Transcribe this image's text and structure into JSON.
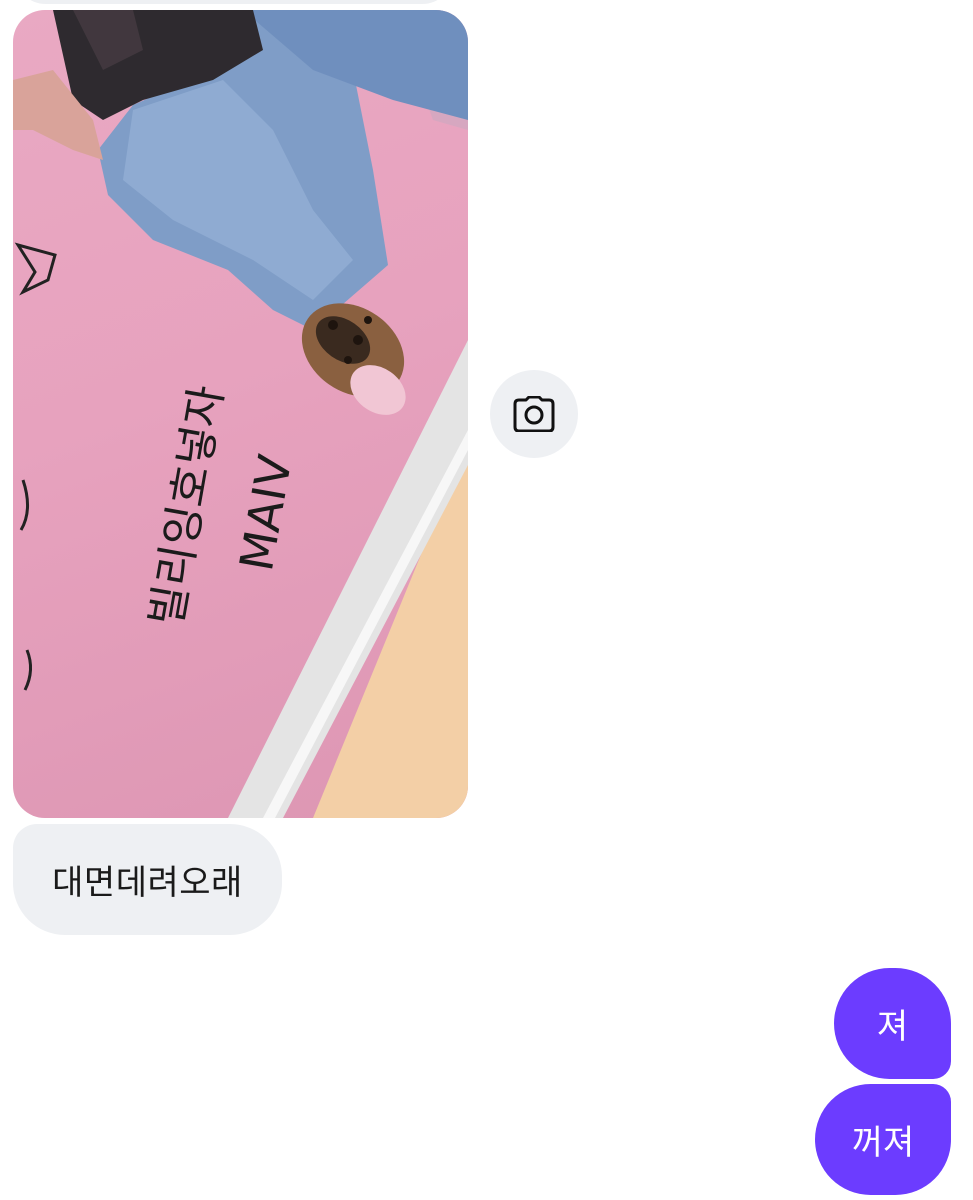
{
  "conversation": {
    "photo_message": {
      "image_description_icon": "photo-icon",
      "handwriting_main": "빌리잉호넣자",
      "handwriting_sub": "MAIV"
    },
    "camera_button": {
      "icon": "camera-icon"
    },
    "received_messages": [
      {
        "text": "대면데려오래"
      }
    ],
    "sent_messages": [
      {
        "text": "져"
      },
      {
        "text": "꺼져"
      }
    ]
  },
  "colors": {
    "received_bubble": "#eef0f3",
    "sent_bubble": "#6c3cff",
    "sent_text": "#ffffff",
    "received_text": "#1a1a1a"
  }
}
